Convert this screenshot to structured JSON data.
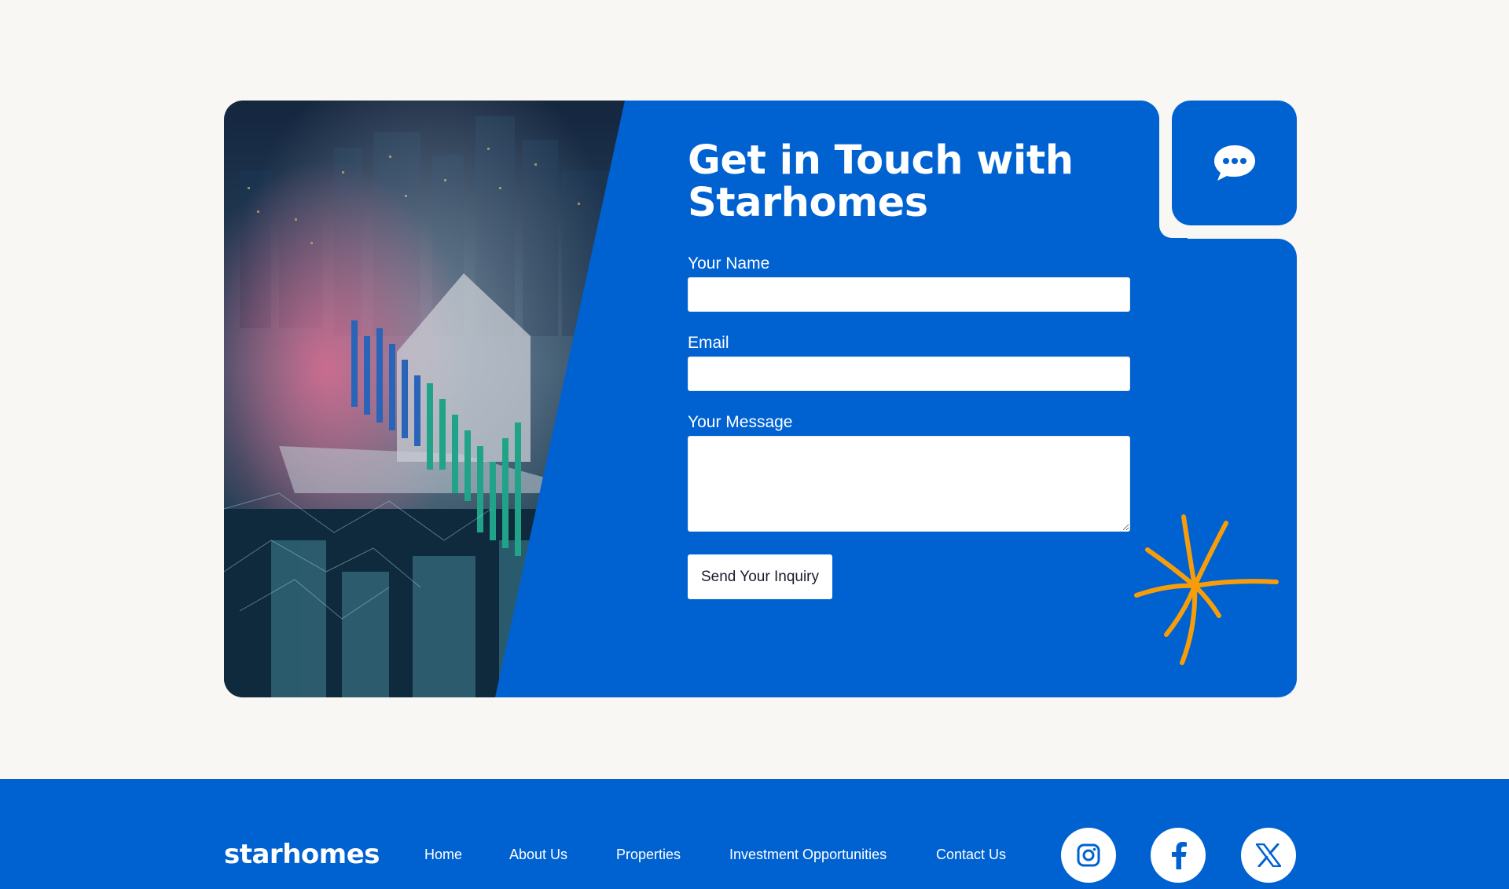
{
  "contact": {
    "title": "Get in Touch with Starhomes",
    "name_label": "Your Name",
    "name_value": "",
    "email_label": "Email",
    "email_value": "",
    "message_label": "Your Message",
    "message_value": "",
    "submit_label": "Send Your Inquiry",
    "chat_icon": "chat-bubble-icon",
    "decor_icon": "starburst-icon"
  },
  "footer": {
    "logo": "starhomes",
    "nav": [
      "Home",
      "About Us",
      "Properties",
      "Investment Opportunities",
      "Contact Us"
    ],
    "social": [
      "instagram-icon",
      "facebook-icon",
      "x-icon"
    ]
  },
  "colors": {
    "brand_blue": "#0062d1",
    "accent_orange": "#f79d0a",
    "page_background": "#f8f7f4",
    "white": "#ffffff"
  }
}
